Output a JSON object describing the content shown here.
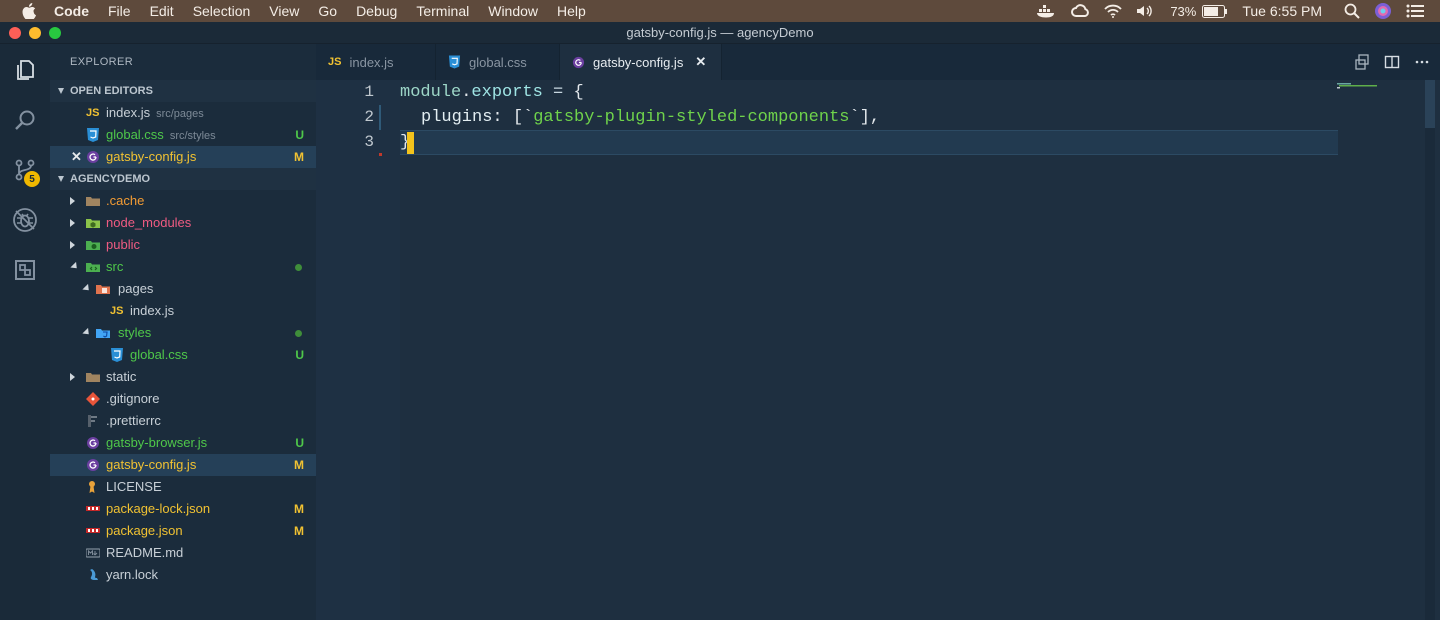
{
  "menubar": {
    "app": "Code",
    "items": [
      "File",
      "Edit",
      "Selection",
      "View",
      "Go",
      "Debug",
      "Terminal",
      "Window",
      "Help"
    ],
    "battery": "73%",
    "clock": "Tue 6:55 PM"
  },
  "window": {
    "title": "gatsby-config.js — agencyDemo"
  },
  "activity": {
    "scm_badge": "5"
  },
  "sidebar": {
    "title": "EXPLORER",
    "open_editors_header": "OPEN EDITORS",
    "open_editors": [
      {
        "name": "index.js",
        "hint": "src/pages",
        "status": ""
      },
      {
        "name": "global.css",
        "hint": "src/styles",
        "status": "U"
      },
      {
        "name": "gatsby-config.js",
        "hint": "",
        "status": "M"
      }
    ],
    "project_header": "AGENCYDEMO",
    "tree": [
      {
        "name": ".cache",
        "status": ""
      },
      {
        "name": "node_modules",
        "status": ""
      },
      {
        "name": "public",
        "status": ""
      },
      {
        "name": "src",
        "status": ""
      },
      {
        "name": "pages",
        "status": ""
      },
      {
        "name": "index.js",
        "status": ""
      },
      {
        "name": "styles",
        "status": ""
      },
      {
        "name": "global.css",
        "status": "U"
      },
      {
        "name": "static",
        "status": ""
      },
      {
        "name": ".gitignore",
        "status": ""
      },
      {
        "name": ".prettierrc",
        "status": ""
      },
      {
        "name": "gatsby-browser.js",
        "status": "U"
      },
      {
        "name": "gatsby-config.js",
        "status": "M"
      },
      {
        "name": "LICENSE",
        "status": ""
      },
      {
        "name": "package-lock.json",
        "status": "M"
      },
      {
        "name": "package.json",
        "status": "M"
      },
      {
        "name": "README.md",
        "status": ""
      },
      {
        "name": "yarn.lock",
        "status": ""
      }
    ]
  },
  "tabs": [
    {
      "label": "index.js",
      "icon_text": "JS"
    },
    {
      "label": "global.css"
    },
    {
      "label": "gatsby-config.js",
      "close": "✕"
    }
  ],
  "editor": {
    "line_numbers": [
      "1",
      "2",
      "3"
    ],
    "line1": {
      "a": "module",
      "b": ".",
      "c": "exports",
      "d": " = ",
      "e": "{"
    },
    "line2": {
      "key": "plugins",
      "colon": ": ",
      "open": "[",
      "tick1": "`",
      "str": "gatsby-plugin-styled-components",
      "tick2": "`",
      "close": "],"
    },
    "line3": "}"
  },
  "colors": {
    "accent": "#f3c31c",
    "modified": "#f1c232",
    "untracked": "#4fc84a"
  }
}
